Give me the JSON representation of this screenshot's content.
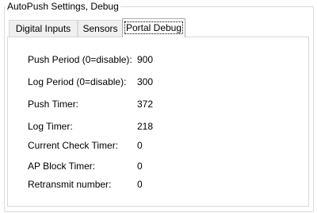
{
  "group": {
    "title": "AutoPush Settings, Debug"
  },
  "tabs": [
    {
      "label": "Digital Inputs",
      "active": false
    },
    {
      "label": "Sensors",
      "active": false
    },
    {
      "label": "Portal Debug",
      "active": true
    }
  ],
  "debug": {
    "rows": [
      {
        "label": "Push Period (0=disable):",
        "value": "900"
      },
      {
        "label": "Log Period (0=disable):",
        "value": "300"
      },
      {
        "label": "Push Timer:",
        "value": "372"
      },
      {
        "label": "Log Timer:",
        "value": "218"
      },
      {
        "label": "Current Check Timer:",
        "value": "0"
      },
      {
        "label": "AP Block Timer:",
        "value": "0"
      },
      {
        "label": "Retransmit number:",
        "value": "0"
      }
    ]
  }
}
